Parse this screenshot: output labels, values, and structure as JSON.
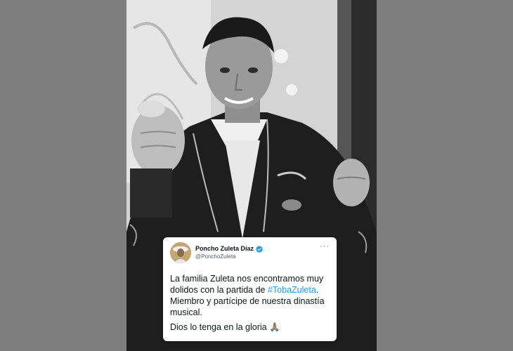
{
  "tweet": {
    "display_name": "Poncho Zuleta Díaz",
    "handle": "@PonchoZuleta",
    "text_before_hashtag": "La familia Zuleta nos encontramos muy dolidos con la partida de ",
    "hashtag": "#TobaZuleta",
    "text_after_hashtag": ". Miembro y partícipe de nuestra dinastía musical.",
    "second_line": "Dios lo tenga en la gloria 🙏🏽",
    "more_icon": "···"
  },
  "colors": {
    "page_background": "#7f7f7f",
    "hashtag": "#1d9bf0",
    "verified_badge": "#1d9bf0"
  },
  "icons": {
    "verified": "verified-badge-icon",
    "more": "more-options-icon"
  }
}
